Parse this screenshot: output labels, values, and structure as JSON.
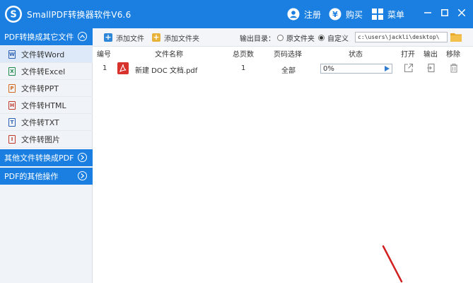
{
  "app": {
    "title": "SmallPDF转换器软件V6.6"
  },
  "titlebar": {
    "login_label": "注册",
    "buy_label": "购买",
    "menu_label": "菜单"
  },
  "sidebar": {
    "section1": "PDF转换成其它文件",
    "items": [
      {
        "label": "文件转Word",
        "icon": "W",
        "color": "#2b5fb3"
      },
      {
        "label": "文件转Excel",
        "icon": "X",
        "color": "#1e8a4c"
      },
      {
        "label": "文件转PPT",
        "icon": "P",
        "color": "#d2691e"
      },
      {
        "label": "文件转HTML",
        "icon": "H",
        "color": "#c0392b"
      },
      {
        "label": "文件转TXT",
        "icon": "T",
        "color": "#2b5fb3"
      },
      {
        "label": "文件转图片",
        "icon": "I",
        "color": "#c0392b"
      }
    ],
    "section2": "其他文件转换成PDF",
    "section3": "PDF的其他操作"
  },
  "toolbar": {
    "add_file": "添加文件",
    "add_folder": "添加文件夹",
    "output_label": "输出目录：",
    "radio_original": "原文件夹",
    "radio_custom": "自定义",
    "path_value": "c:\\users\\jackli\\desktop\\"
  },
  "table": {
    "headers": [
      "编号",
      "文件名称",
      "总页数",
      "页码选择",
      "状态",
      "打开",
      "输出",
      "移除"
    ],
    "rows": [
      {
        "index": "1",
        "name": "新建 DOC 文档.pdf",
        "pages": "1",
        "page_select": "全部",
        "progress": "0%"
      }
    ]
  },
  "colors": {
    "accent": "#1a7fe0",
    "annotation": "#d21f1f"
  }
}
